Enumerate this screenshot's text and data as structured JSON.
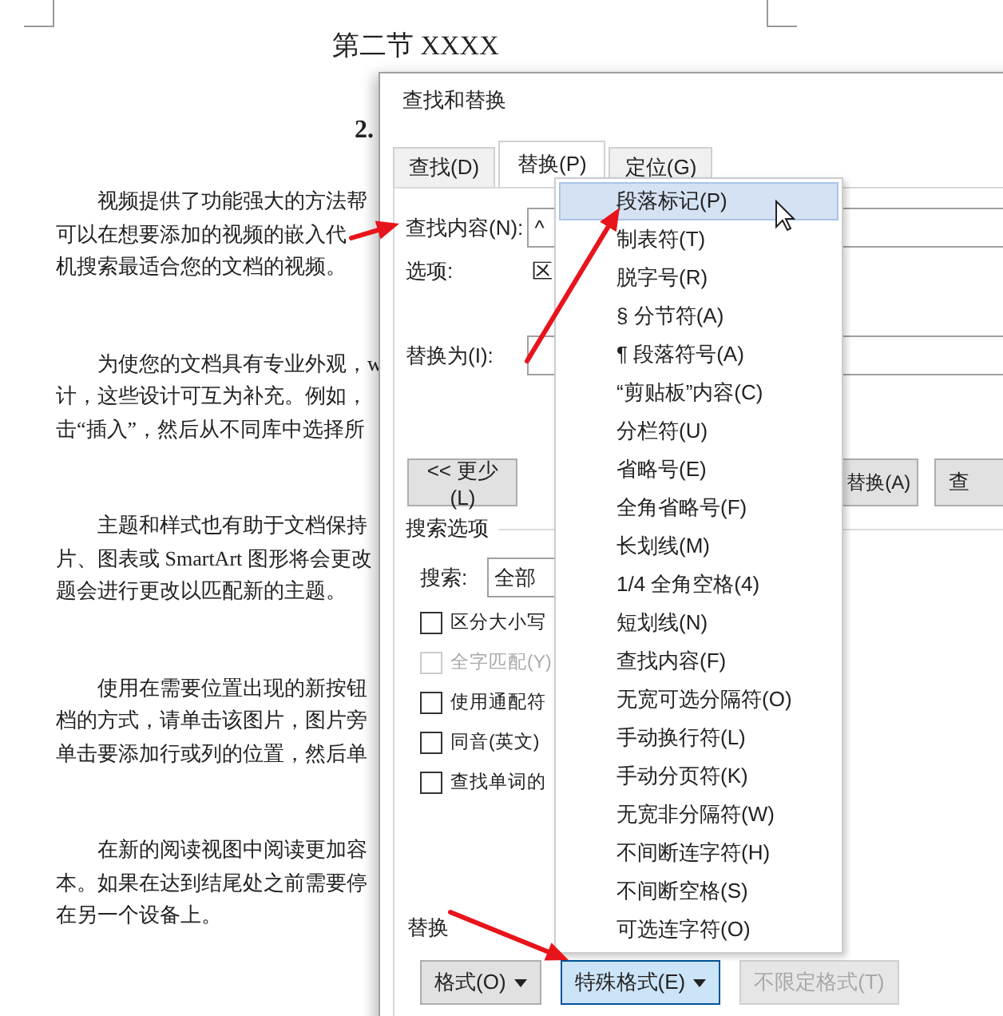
{
  "document": {
    "heading": "第二节 XXXX",
    "subheading": "2.",
    "paragraphs": [
      [
        "视频提供了功能强大的方法帮",
        "可以在想要添加的视频的嵌入代",
        "机搜索最适合您的文档的视频。"
      ],
      [
        "为使您的文档具有专业外观，w",
        "计，这些设计可互为补充。例如，",
        "击“插入”，然后从不同库中选择所"
      ],
      [
        "主题和样式也有助于文档保持",
        "片、图表或 SmartArt 图形将会更改",
        "题会进行更改以匹配新的主题。"
      ],
      [
        "使用在需要位置出现的新按钮",
        "档的方式，请单击该图片，图片旁",
        "单击要添加行或列的位置，然后单"
      ],
      [
        "在新的阅读视图中阅读更加容",
        "本。如果在达到结尾处之前需要停",
        "在另一个设备上。"
      ]
    ]
  },
  "dialog": {
    "title": "查找和替换",
    "tabs": [
      {
        "label": "查找(D)",
        "selected": false
      },
      {
        "label": "替换(P)",
        "selected": true
      },
      {
        "label": "定位(G)",
        "selected": false
      }
    ],
    "find_label": "查找内容(N):",
    "find_value": "^",
    "options_label": "选项:",
    "options_value": "区",
    "replace_label": "替换为(I):",
    "less_button": "<< 更少(L)",
    "replace_all_button": "替换(A)",
    "find_next_button": "查",
    "search_options_label": "搜索选项",
    "search_label": "搜索:",
    "search_value": "全部",
    "checkboxes": [
      {
        "label": "区分大小写",
        "checked": false,
        "disabled": false
      },
      {
        "label": "全字匹配(Y)",
        "checked": false,
        "disabled": true
      },
      {
        "label": "使用通配符",
        "checked": false,
        "disabled": false
      },
      {
        "label": "同音(英文)",
        "checked": false,
        "disabled": false
      },
      {
        "label": "查找单词的",
        "checked": false,
        "disabled": false
      }
    ],
    "replace_section_label": "替换",
    "bottom_buttons": [
      {
        "label": "格式(O)",
        "kind": "dropdown",
        "selected": false,
        "disabled": false
      },
      {
        "label": "特殊格式(E)",
        "kind": "dropdown",
        "selected": true,
        "disabled": false
      },
      {
        "label": "不限定格式(T)",
        "kind": "plain",
        "selected": false,
        "disabled": true
      }
    ]
  },
  "special_menu": {
    "items": [
      {
        "label": "段落标记(P)",
        "selected": true
      },
      {
        "label": "制表符(T)",
        "selected": false
      },
      {
        "label": "脱字号(R)",
        "selected": false
      },
      {
        "label": "§ 分节符(A)",
        "selected": false
      },
      {
        "label": "¶ 段落符号(A)",
        "selected": false
      },
      {
        "label": "“剪贴板”内容(C)",
        "selected": false
      },
      {
        "label": "分栏符(U)",
        "selected": false
      },
      {
        "label": "省略号(E)",
        "selected": false
      },
      {
        "label": "全角省略号(F)",
        "selected": false
      },
      {
        "label": "长划线(M)",
        "selected": false
      },
      {
        "label": "1/4 全角空格(4)",
        "selected": false
      },
      {
        "label": "短划线(N)",
        "selected": false
      },
      {
        "label": "查找内容(F)",
        "selected": false
      },
      {
        "label": "无宽可选分隔符(O)",
        "selected": false
      },
      {
        "label": "手动换行符(L)",
        "selected": false
      },
      {
        "label": "手动分页符(K)",
        "selected": false
      },
      {
        "label": "无宽非分隔符(W)",
        "selected": false
      },
      {
        "label": "不间断连字符(H)",
        "selected": false
      },
      {
        "label": "不间断空格(S)",
        "selected": false
      },
      {
        "label": "可选连字符(O)",
        "selected": false
      }
    ]
  }
}
